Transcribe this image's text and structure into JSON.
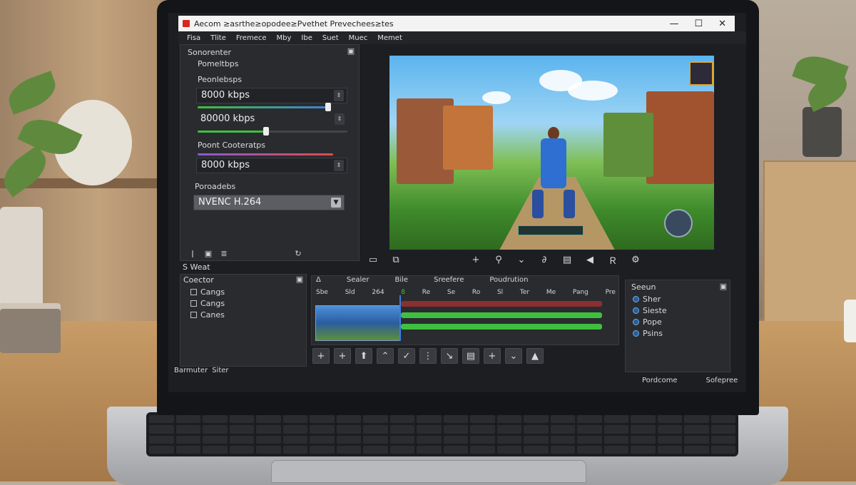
{
  "window": {
    "title": "Aecom ≥asrthe≥opodee≥Pvethet Prevechees≥tes",
    "minimize": "—",
    "maximize": "☐",
    "close": "✕"
  },
  "menu": [
    "Fisa",
    "Tlite",
    "Fremece",
    "Mby",
    "Ibe",
    "Suet",
    "Muec",
    "Memet"
  ],
  "settings": {
    "header": "Sonorenter",
    "sub": "Pomeltbps",
    "group1_label": "Peonlebsps",
    "bitrate1": "8000 kbps",
    "bitrate2": "80000 kbps",
    "group2_label": "Poont Cooteratps",
    "bitrate3": "8000 kbps",
    "encoder_label": "Poroadebs",
    "encoder": "NVENC H.264"
  },
  "scene_panel": {
    "header": "S Weat",
    "subheader": "Coector",
    "items": [
      "Cangs",
      "Cangs",
      "Canes"
    ]
  },
  "timeline": {
    "tabs": [
      "Δ",
      "Sealer",
      "Bile",
      "Sreefere",
      "Poudrution"
    ],
    "columns": [
      "Sbe",
      "Sld",
      "264",
      "8",
      "Re",
      "Se",
      "Ro",
      "Sl",
      "Ter",
      "Me",
      "Pang",
      "Pre"
    ]
  },
  "sources": {
    "header": "Seeun",
    "items": [
      "Sher",
      "Sieste",
      "Pope",
      "Psins"
    ]
  },
  "status": {
    "left1": "Barmuter",
    "left2": "Siter",
    "right1": "Pordcome",
    "right2": "Sofepree"
  },
  "colors": {
    "accent_blue": "#3f7fd9",
    "accent_green": "#3fbf3f",
    "accent_red": "#c64545",
    "accent_purple": "#8a5ad6"
  }
}
